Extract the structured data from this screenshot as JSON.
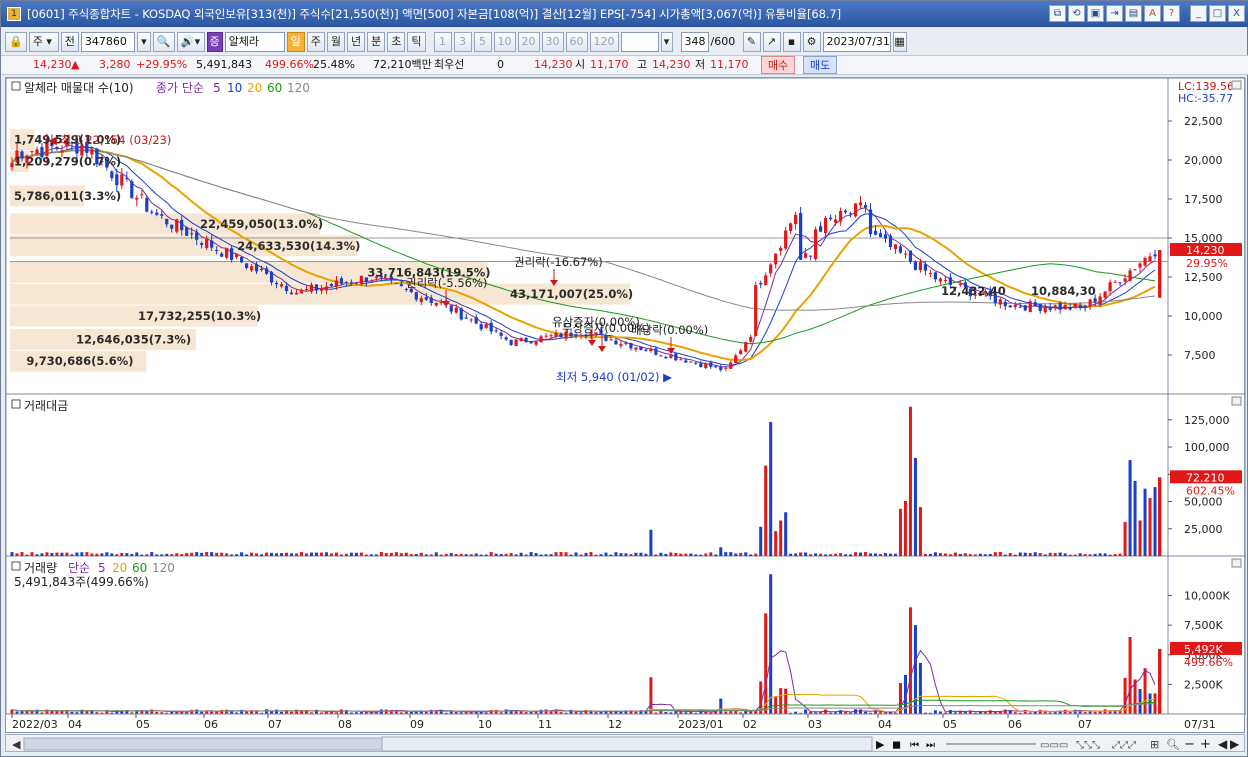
{
  "window": {
    "title": "[0601] 주식종합차트 - KOSDAQ 외국인보유[313(천)] 주식수[21,550(천)] 액면[500] 자본금[108(억)] 결산[12월] EPS[-754] 시가총액[3,067(억)] 유통비율[68.7]",
    "app_icon": "1",
    "title_buttons": [
      "⧉",
      "⟲",
      "▣",
      "⇥",
      "▤",
      "A",
      "?"
    ],
    "window_controls": [
      "_",
      "□",
      "X"
    ]
  },
  "toolbar": {
    "stock_marker": "주",
    "market_label": "전",
    "code": "347860",
    "stock_name": "알체라",
    "stock_name_badge": "증",
    "periods": [
      "일",
      "주",
      "월",
      "년",
      "분",
      "초",
      "틱"
    ],
    "active_period": "일",
    "minute_units": [
      "1",
      "3",
      "5",
      "10",
      "20",
      "30",
      "60",
      "120"
    ],
    "count": "348",
    "count_total": "/600",
    "date": "2023/07/31"
  },
  "quote": {
    "price": "14,230",
    "change": "3,280",
    "change_pct": "+29.95%",
    "volume": "5,491,843",
    "volume_pct": "499.66%",
    "turnover": "25.48%",
    "amount": "72,210백만",
    "priority_label": "최우선",
    "priority_value": "0",
    "bid_price": "14,230",
    "open_label": "시",
    "open": "11,170",
    "high_label": "고",
    "high": "14,230",
    "low_label": "저",
    "low": "11,170",
    "buy_label": "매수",
    "sell_label": "매도"
  },
  "price_panel": {
    "legend_title": "알체라 매물대 수(10)",
    "ma_legend": {
      "label": "종가 단순",
      "periods": [
        "5",
        "10",
        "20",
        "60",
        "120"
      ],
      "colors": [
        "#7b2fa0",
        "#1a3fc8",
        "#e8a300",
        "#1a9a1a",
        "#888888"
      ]
    },
    "lc": "LC:139.56",
    "hc": "HC:-35.77",
    "y_ticks": [
      22500,
      20000,
      17500,
      15000,
      12500,
      10000,
      7500
    ],
    "y_tick_labels": [
      "22,500",
      "20,000",
      "17,500",
      "15,000",
      "12,500",
      "10,000",
      "7,500"
    ],
    "ylim": [
      5000,
      25000
    ],
    "current_price_label": "14,230",
    "current_pct_label": "29.95%",
    "high_annotation": "최고 22,154 (03/23)",
    "low_annotation": "최저 5,940 (01/02)",
    "events": [
      {
        "text": "권리락(-5.56%)",
        "price": 11800
      },
      {
        "text": "권리락(-16.67%)",
        "price": 13800
      },
      {
        "text": "유상증자(0.00%)",
        "price": 9300
      },
      {
        "text": "무상증자(0.00%)",
        "price": 8800
      },
      {
        "text": "배당락(0.00%)",
        "price": 8700
      }
    ],
    "volume_profile": [
      {
        "label": "1,749,529(1.0%)",
        "price": 21300,
        "width": 0.04
      },
      {
        "label": "1,209,279(0.7%)",
        "price": 19900,
        "width": 0.03
      },
      {
        "label": "5,786,011(3.3%)",
        "price": 17700,
        "width": 0.12
      },
      {
        "label": "22,459,050(13.0%)",
        "price": 15900,
        "width": 0.5
      },
      {
        "label": "24,633,530(14.3%)",
        "price": 14500,
        "width": 0.56
      },
      {
        "label": "33,716,843(19.5%)",
        "price": 12800,
        "width": 0.77
      },
      {
        "label": "43,171,007(25.0%)",
        "price": 11400,
        "width": 1.0
      },
      {
        "label": "17,732,255(10.3%)",
        "price": 10000,
        "width": 0.4
      },
      {
        "label": "12,646,035(7.3%)",
        "price": 8500,
        "width": 0.3
      },
      {
        "label": "9,730,686(5.6%)",
        "price": 7100,
        "width": 0.22
      }
    ],
    "extra_labels": [
      "12,432,40",
      "10,884,30"
    ]
  },
  "amount_panel": {
    "title": "거래대금",
    "y_ticks": [
      125000,
      100000,
      75000,
      50000,
      25000
    ],
    "y_tick_labels": [
      "125,000",
      "100,000",
      "75,000",
      "50,000",
      "25,000"
    ],
    "ylim": [
      0,
      145000
    ],
    "current_label": "72,210",
    "current_pct": "602.45%"
  },
  "volume_panel": {
    "title": "거래량",
    "ma_label": "단순",
    "ma_periods": [
      "5",
      "20",
      "60",
      "120"
    ],
    "ma_colors": [
      "#7b2fa0",
      "#e8a300",
      "#1a9a1a",
      "#888888"
    ],
    "summary": "5,491,843주(499.66%)",
    "y_ticks": [
      10000,
      7500,
      5000,
      2500
    ],
    "y_tick_labels": [
      "10,000K",
      "7,500K",
      "5,000K",
      "2,500K"
    ],
    "ylim": [
      0,
      13000
    ],
    "current_label": "5,492K",
    "current_pct": "499.66%"
  },
  "x_axis": {
    "labels": [
      "2022/03",
      "04",
      "05",
      "06",
      "07",
      "08",
      "09",
      "10",
      "11",
      "12",
      "2023/01",
      "02",
      "03",
      "04",
      "05",
      "06",
      "07"
    ],
    "right_label": "07/31"
  },
  "chart_data": {
    "type": "candlestick",
    "x": [
      "2022-03",
      "2022-04",
      "2022-05",
      "2022-06",
      "2022-07",
      "2022-08",
      "2022-09",
      "2022-10",
      "2022-11",
      "2022-12",
      "2023-01",
      "2023-02",
      "2023-03",
      "2023-04",
      "2023-05",
      "2023-06",
      "2023-07"
    ],
    "close_approx": [
      20500,
      21000,
      16500,
      14000,
      11500,
      12500,
      10800,
      8300,
      9000,
      7700,
      6500,
      13500,
      15300,
      12200,
      10700,
      10500,
      14230
    ],
    "y_range": [
      5000,
      25000
    ],
    "high": {
      "value": 22154,
      "date": "03/23"
    },
    "low": {
      "value": 5940,
      "date": "01/02"
    }
  }
}
